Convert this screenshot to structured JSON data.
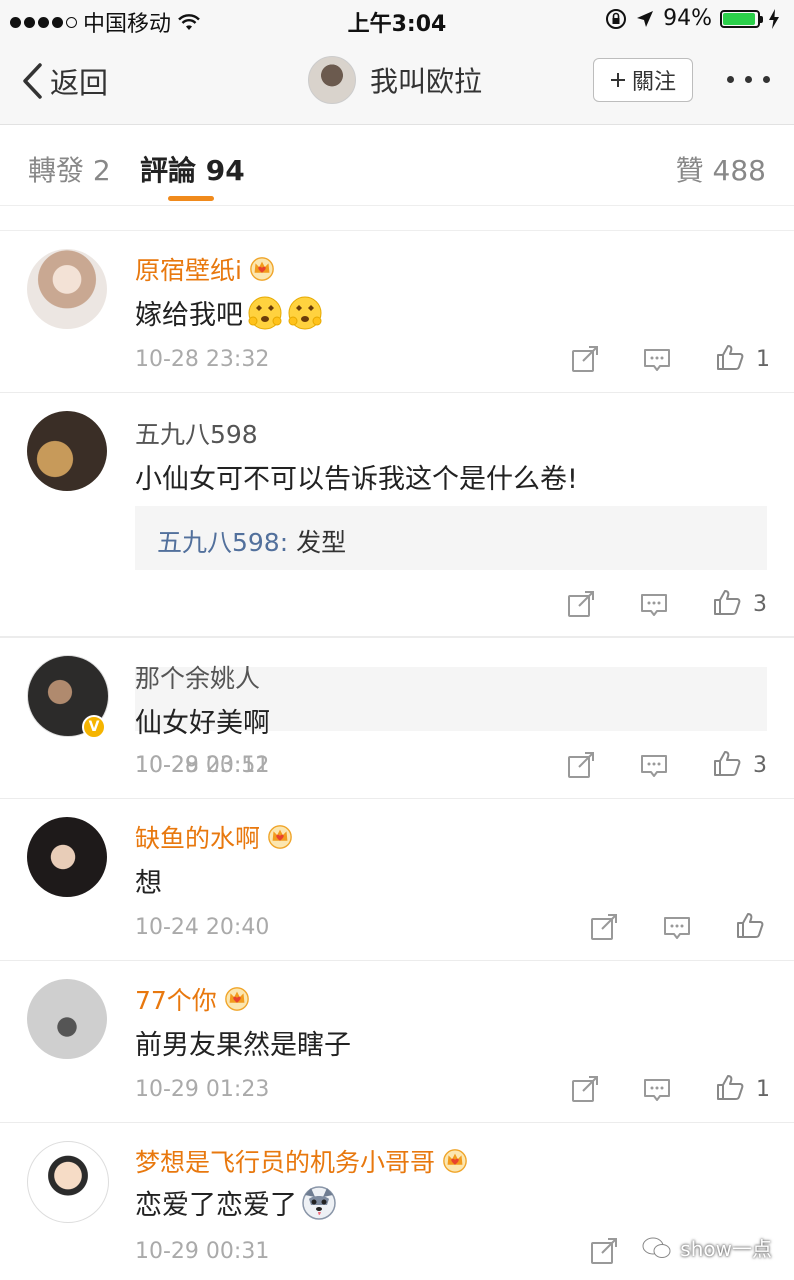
{
  "status_bar": {
    "carrier": "中国移动",
    "time": "上午3:04",
    "battery_percent": "94%",
    "battery_level": 0.94,
    "battery_color": "#2bd04a"
  },
  "nav": {
    "back_label": "返回",
    "title": "我叫欧拉",
    "follow_label": "關注"
  },
  "tabs": {
    "repost": "轉發 2",
    "comments": "評論 94",
    "likes": "贊 488",
    "accent_color": "#f08a1c"
  },
  "comments": [
    {
      "name": "原宿壁纸i",
      "vip": true,
      "text": "嫁给我吧",
      "emoji": [
        "hug-emoji",
        "hug-emoji"
      ],
      "time": "10-28 23:32",
      "likes": "1"
    },
    {
      "name": "五九八598",
      "vip": false,
      "text": "小仙女可不可以告诉我这个是什么卷!",
      "reply": {
        "name": "五九八598:",
        "text": "发型"
      },
      "time": "10-29 00:12",
      "likes": "3"
    },
    {
      "name": "那个余姚人",
      "vip": false,
      "verified": "V",
      "text": "仙女好美啊",
      "time": "10-28 23:51",
      "likes": "3"
    },
    {
      "name": "缺鱼的水啊",
      "vip": true,
      "text": "想",
      "time": "10-24 20:40",
      "likes": ""
    },
    {
      "name": "77个你",
      "vip": true,
      "text": "前男友果然是瞎子",
      "time": "10-29 01:23",
      "likes": "1"
    },
    {
      "name": "梦想是飞行员的机务小哥哥",
      "vip": true,
      "text": "恋爱了恋爱了",
      "emoji": [
        "husky-emoji"
      ],
      "time": "10-29 00:31",
      "likes": ""
    }
  ],
  "watermark": "show一点",
  "vip_name_color": "#e8780e"
}
